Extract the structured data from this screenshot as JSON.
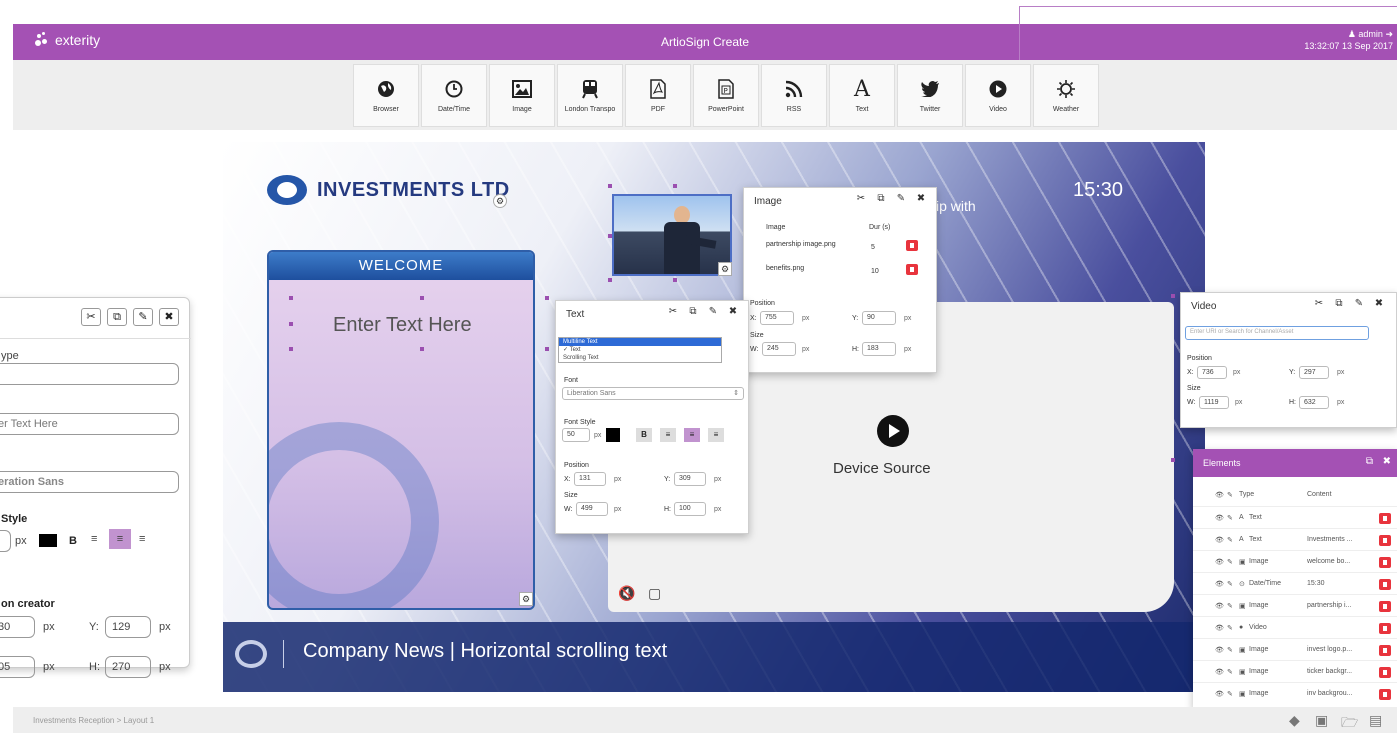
{
  "header": {
    "logo": "exterity",
    "title": "ArtioSign Create",
    "user": "admin",
    "datetime": "13:32:07 13 Sep 2017"
  },
  "toolbar": {
    "tools": [
      {
        "label": "Browser",
        "icon": "globe-icon"
      },
      {
        "label": "Date/Time",
        "icon": "clock-icon"
      },
      {
        "label": "Image",
        "icon": "image-icon"
      },
      {
        "label": "London Transpo",
        "icon": "train-icon"
      },
      {
        "label": "PDF",
        "icon": "pdf-icon"
      },
      {
        "label": "PowerPoint",
        "icon": "powerpoint-icon"
      },
      {
        "label": "RSS",
        "icon": "rss-icon"
      },
      {
        "label": "Text",
        "icon": "text-icon"
      },
      {
        "label": "Twitter",
        "icon": "twitter-icon"
      },
      {
        "label": "Video",
        "icon": "play-icon"
      },
      {
        "label": "Weather",
        "icon": "sun-icon"
      }
    ]
  },
  "canvas": {
    "company": "INVESTMENTS LTD",
    "clock": "15:30",
    "partnership_text": "ip with",
    "welcome": "WELCOME",
    "enter_text": "Enter Text Here",
    "device_source": "Device Source",
    "ticker": "Company News | Horizontal scrolling text"
  },
  "image_panel": {
    "title": "Image",
    "col_image": "Image",
    "col_dur": "Dur (s)",
    "rows": [
      {
        "name": "partnership image.png",
        "dur": "5"
      },
      {
        "name": "benefits.png",
        "dur": "10"
      }
    ],
    "position_label": "Position",
    "size_label": "Size",
    "x_label": "X:",
    "x": "755",
    "y_label": "Y:",
    "y": "90",
    "w_label": "W:",
    "w": "245",
    "h_label": "H:",
    "h": "183",
    "unit": "px"
  },
  "text_panel": {
    "title": "Text",
    "type_options": [
      "Multiline Text",
      "✓ Text",
      "Scrolling Text"
    ],
    "font_label": "Font",
    "font": "Liberation Sans",
    "font_style_label": "Font Style",
    "font_size": "50",
    "unit": "px",
    "bold": "B",
    "position_label": "Position",
    "size_label": "Size",
    "x_label": "X:",
    "x": "131",
    "y_label": "Y:",
    "y": "309",
    "w_label": "W:",
    "w": "499",
    "h_label": "H:",
    "h": "100"
  },
  "video_panel": {
    "title": "Video",
    "placeholder": "Enter URI or Search for Channel/Asset",
    "position_label": "Position",
    "size_label": "Size",
    "x_label": "X:",
    "x": "736",
    "y_label": "Y:",
    "y": "297",
    "w_label": "W:",
    "w": "1119",
    "h_label": "H:",
    "h": "632",
    "unit": "px"
  },
  "left_panel": {
    "type_label": "ype",
    "text_value": "er Text Here",
    "font_value": "eration Sans",
    "style_label": "Style",
    "unit": "px",
    "bold": "B",
    "position_label": "on creator",
    "x_value": "30",
    "y_label": "Y:",
    "y_value": "129",
    "w_value": "05",
    "h_label": "H:",
    "h_value": "270"
  },
  "elements_panel": {
    "title": "Elements",
    "col_type": "Type",
    "col_content": "Content",
    "rows": [
      {
        "type": "Text",
        "icon": "A",
        "content": ""
      },
      {
        "type": "Text",
        "icon": "A",
        "content": "Investments ..."
      },
      {
        "type": "Image",
        "icon": "▣",
        "content": "welcome bo..."
      },
      {
        "type": "Date/Time",
        "icon": "⊙",
        "content": "15:30"
      },
      {
        "type": "Image",
        "icon": "▣",
        "content": "partnership i..."
      },
      {
        "type": "Video",
        "icon": "●",
        "content": ""
      },
      {
        "type": "Image",
        "icon": "▣",
        "content": "invest logo.p..."
      },
      {
        "type": "Image",
        "icon": "▣",
        "content": "ticker backgr..."
      },
      {
        "type": "Image",
        "icon": "▣",
        "content": "inv backgrou..."
      }
    ]
  },
  "footer": {
    "breadcrumb": "Investments Reception > Layout 1"
  },
  "colors": {
    "brand": "#a451b4",
    "delete": "#e8343d",
    "accent_active": "#c193cf"
  }
}
